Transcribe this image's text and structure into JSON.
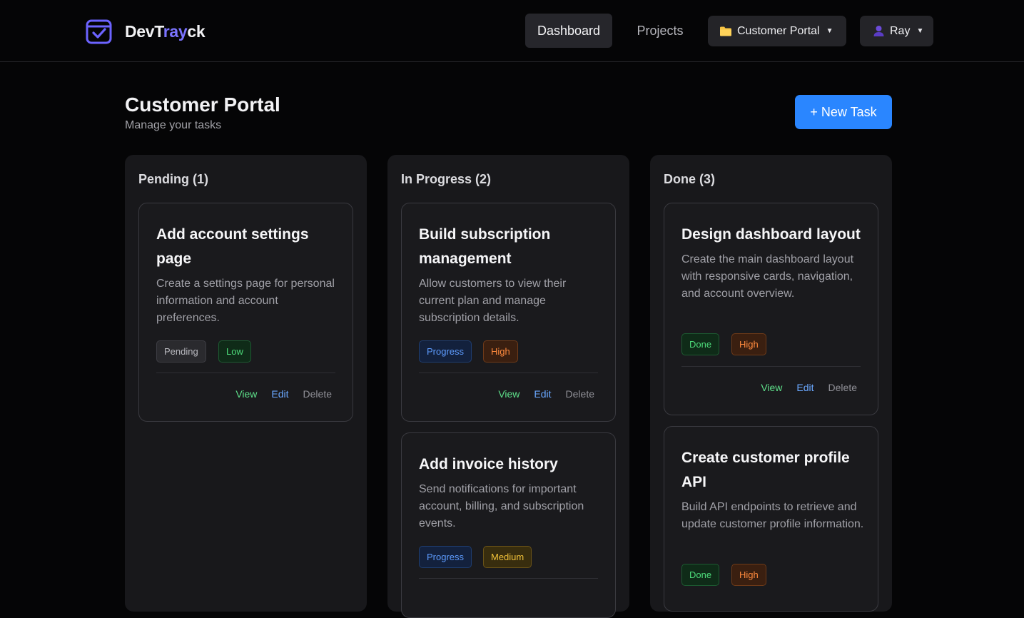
{
  "app": {
    "brand_prefix": "DevT",
    "brand_accent": "ray",
    "brand_suffix": "ck",
    "accent_color": "#7b74ff"
  },
  "nav": {
    "dashboard": "Dashboard",
    "projects": "Projects",
    "project_selector": "Customer Portal",
    "project_icon": "folder-icon",
    "user": "Ray",
    "user_icon": "user-icon"
  },
  "page": {
    "title": "Customer Portal",
    "subtitle": "Manage your tasks",
    "new_task_label": "+ New Task"
  },
  "columns": [
    {
      "title": "Pending (1)",
      "cards": [
        {
          "title": "Add account settings page",
          "description": "Create a settings page for personal information and account preferences.",
          "status": "Pending",
          "priority": "Low"
        }
      ]
    },
    {
      "title": "In Progress (2)",
      "cards": [
        {
          "title": "Build subscription management",
          "description": "Allow customers to view their current plan and manage subscription details.",
          "status": "Progress",
          "priority": "High"
        },
        {
          "title": "Add invoice history",
          "description": "Send notifications for important account, billing, and subscription events.",
          "status": "Progress",
          "priority": "Medium"
        }
      ]
    },
    {
      "title": "Done (3)",
      "cards": [
        {
          "title": "Design dashboard layout",
          "description": "Create the main dashboard layout with responsive cards, navigation, and account overview.",
          "status": "Done",
          "priority": "High"
        },
        {
          "title": "Create customer profile API",
          "description": "Build API endpoints to retrieve and update customer profile information.",
          "status": "Done",
          "priority": "High"
        }
      ]
    }
  ],
  "card_actions": {
    "view": "View",
    "edit": "Edit",
    "delete": "Delete"
  }
}
